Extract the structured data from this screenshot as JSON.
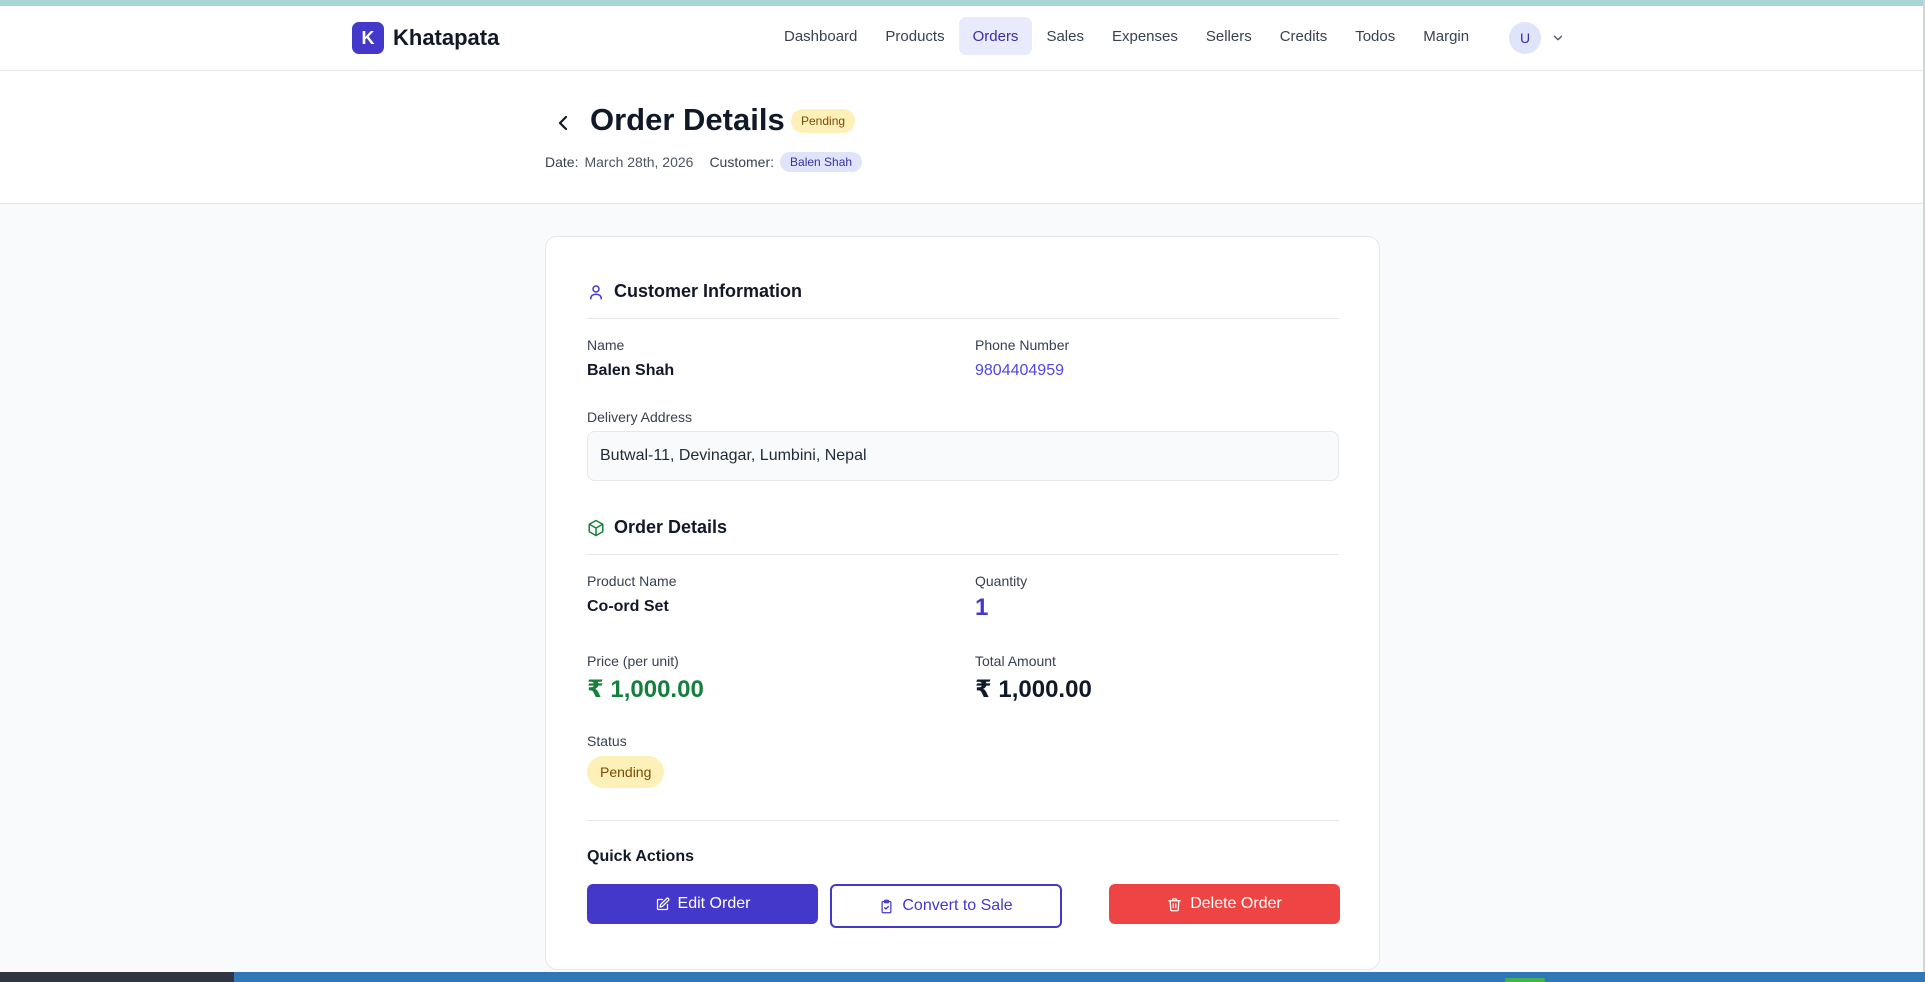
{
  "brand": {
    "logo_letter": "K",
    "name": "Khatapata"
  },
  "nav": {
    "items": [
      "Dashboard",
      "Products",
      "Orders",
      "Sales",
      "Expenses",
      "Sellers",
      "Credits",
      "Todos",
      "Margin"
    ],
    "active": "Orders"
  },
  "user": {
    "initial": "U"
  },
  "header": {
    "title": "Order Details",
    "status_badge": "Pending",
    "date_label": "Date:",
    "date_value": "March 28th, 2026",
    "customer_label": "Customer:",
    "customer_value": "Balen Shah"
  },
  "customer_info": {
    "title": "Customer Information",
    "name_label": "Name",
    "name_value": "Balen Shah",
    "phone_label": "Phone Number",
    "phone_value": "9804404959",
    "address_label": "Delivery Address",
    "address_value": "Butwal-11, Devinagar, Lumbini, Nepal"
  },
  "order_details": {
    "title": "Order Details",
    "product_label": "Product Name",
    "product_value": "Co-ord Set",
    "quantity_label": "Quantity",
    "quantity_value": "1",
    "price_label": "Price (per unit)",
    "price_value": "₹ 1,000.00",
    "total_label": "Total Amount",
    "total_value": "₹ 1,000.00",
    "status_label": "Status",
    "status_value": "Pending"
  },
  "quick_actions": {
    "title": "Quick Actions",
    "edit_label": "Edit Order",
    "convert_label": "Convert to Sale",
    "delete_label": "Delete Order"
  },
  "colors": {
    "primary": "#4338ca",
    "success": "#15803d",
    "danger": "#ef4444",
    "pending_bg": "#fdf0b8",
    "pending_text": "#7c4a03"
  }
}
